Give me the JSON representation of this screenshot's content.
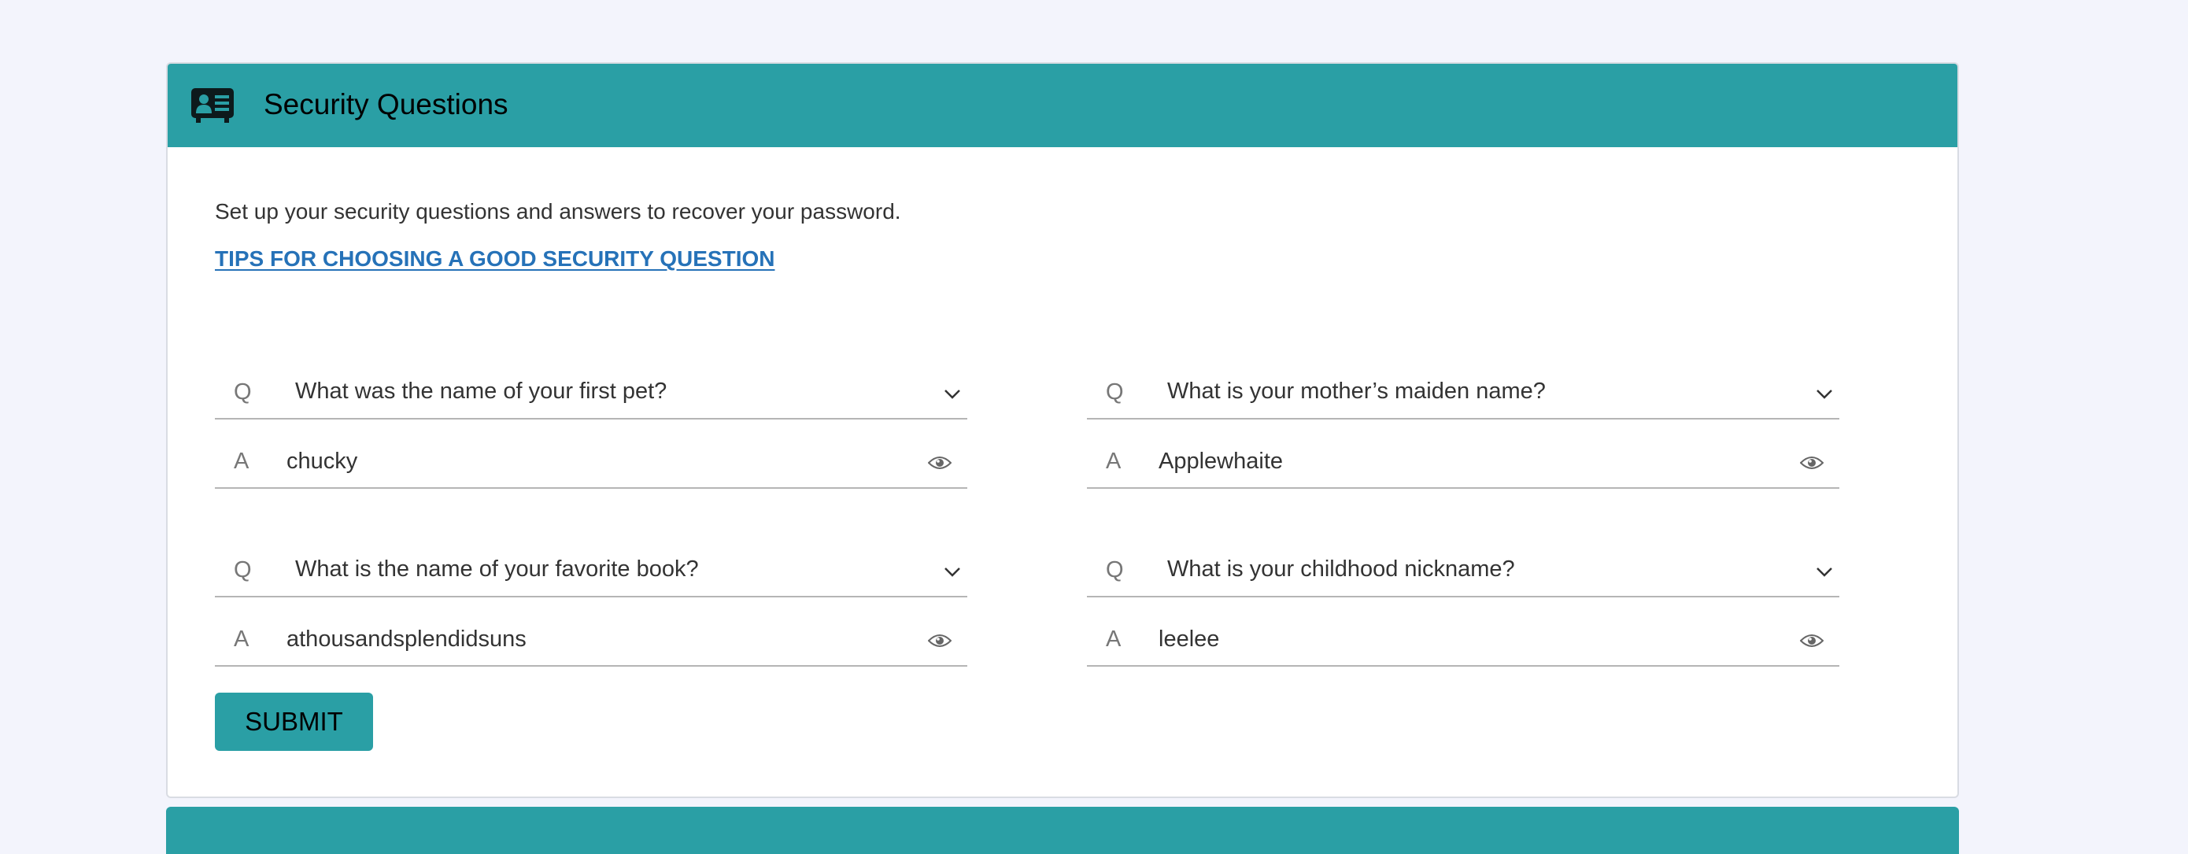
{
  "header": {
    "title": "Security Questions",
    "icon": "id-card-icon",
    "background_color": "#2a9fa5"
  },
  "intro_text": "Set up your security questions and answers to recover your password.",
  "tips_link": "TIPS FOR CHOOSING A GOOD SECURITY QUESTION",
  "labels": {
    "question_prefix": "Q",
    "answer_prefix": "A"
  },
  "questions": [
    {
      "question": "What was the name of your first pet?",
      "answer": "chucky"
    },
    {
      "question": "What is your mother’s maiden name?",
      "answer": "Applewhaite"
    },
    {
      "question": "What is the name of your favorite book?",
      "answer": "athousandsplendidsuns"
    },
    {
      "question": "What is your childhood nickname?",
      "answer": "leelee"
    }
  ],
  "submit_label": "SUBMIT",
  "colors": {
    "accent": "#2a9fa5",
    "link": "#2672b8",
    "page_background": "#f3f4fc"
  }
}
